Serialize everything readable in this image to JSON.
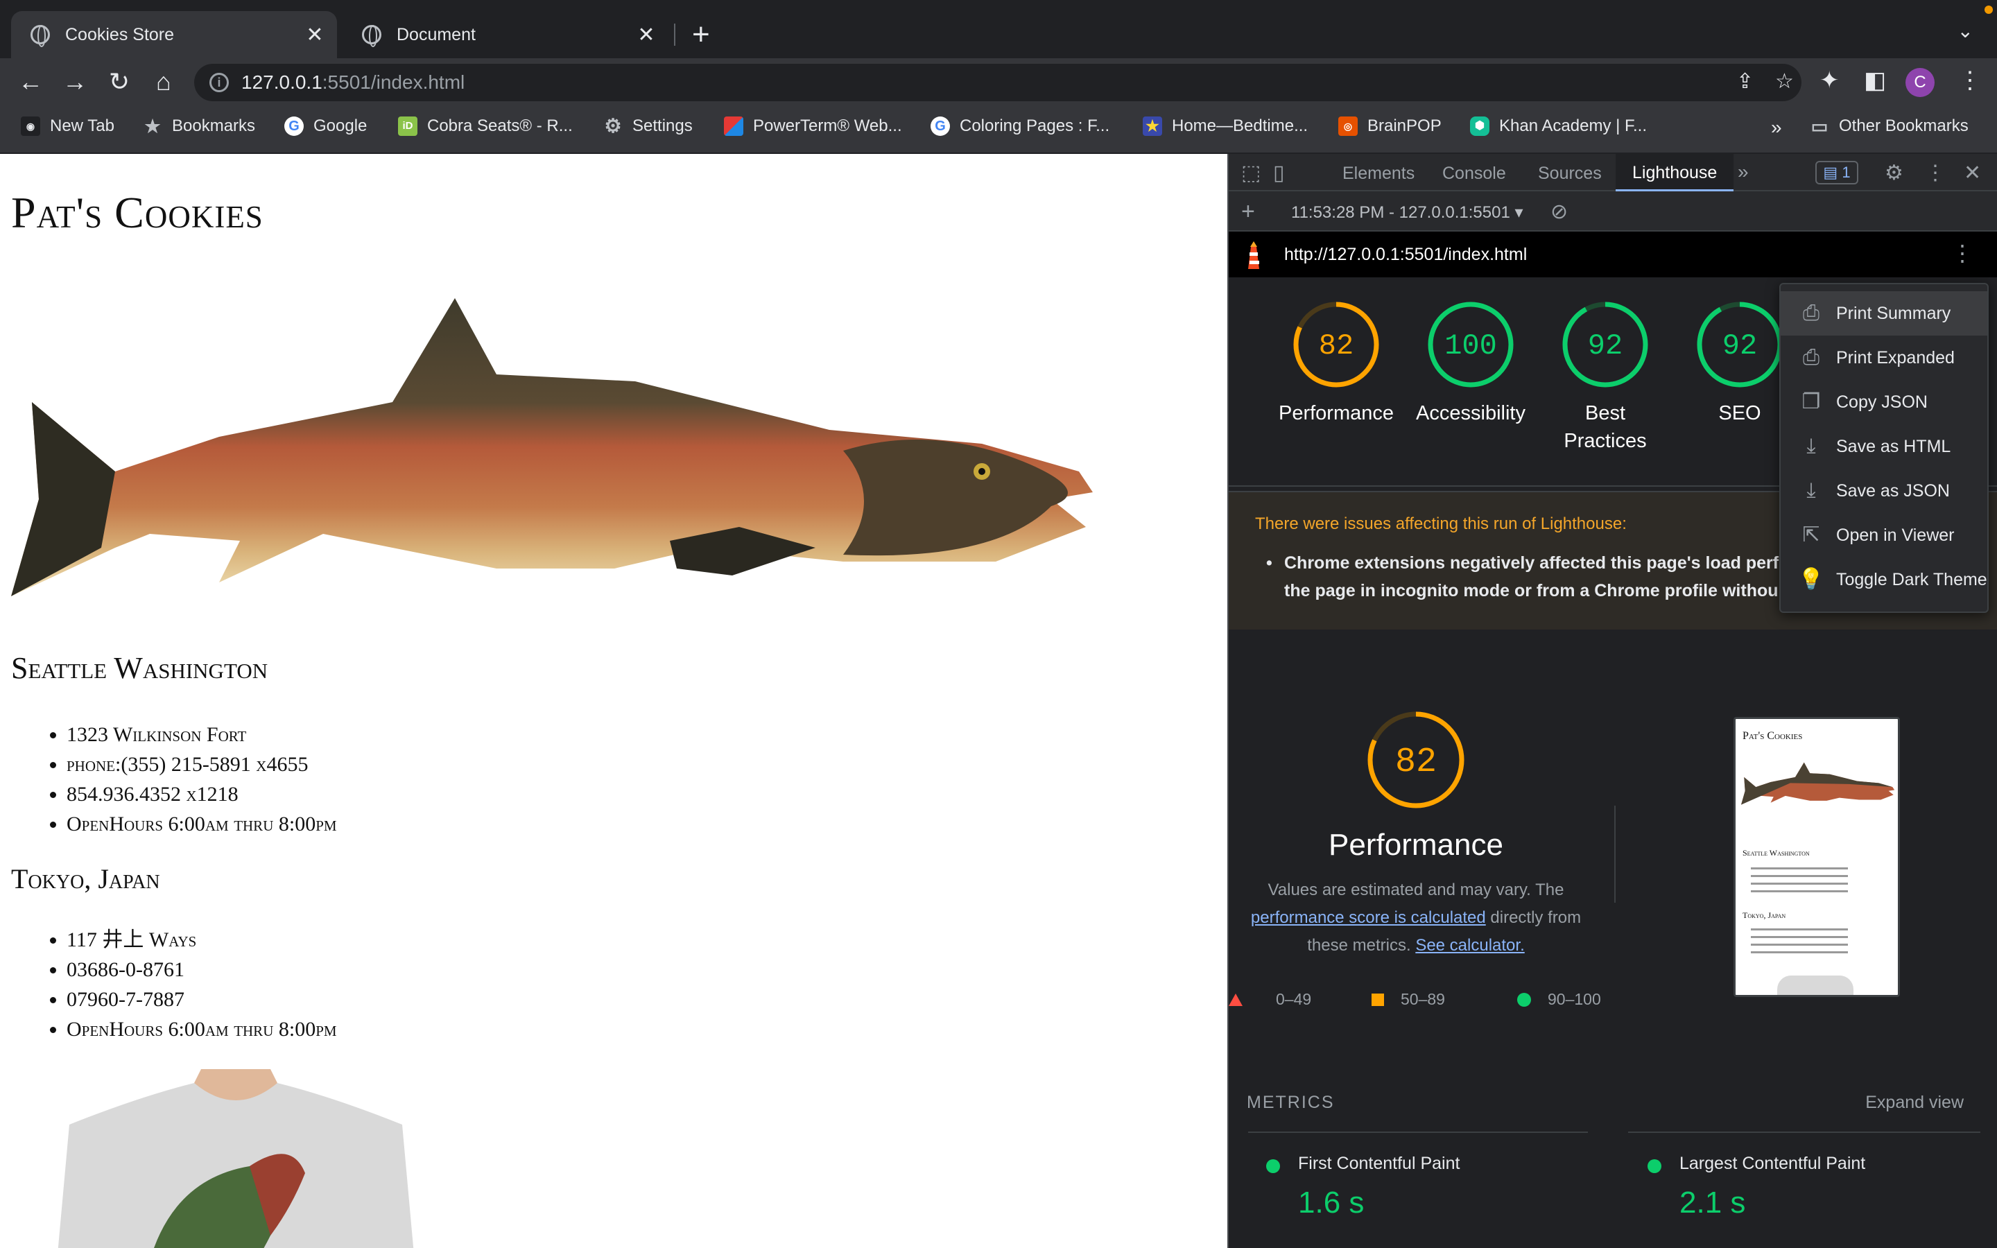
{
  "tabs": [
    {
      "title": "Cookies Store",
      "active": true
    },
    {
      "title": "Document",
      "active": false
    }
  ],
  "address_bar": {
    "host": "127.0.0.1",
    "rest": ":5501/index.html"
  },
  "bookmarks": [
    {
      "label": "New Tab",
      "icon": "new-tab-icon"
    },
    {
      "label": "Bookmarks",
      "icon": "star-icon"
    },
    {
      "label": "Google",
      "icon": "google-icon"
    },
    {
      "label": "Cobra Seats® - R...",
      "icon": "cobra-icon"
    },
    {
      "label": "Settings",
      "icon": "gear-icon"
    },
    {
      "label": "PowerTerm® Web...",
      "icon": "powerterm-icon"
    },
    {
      "label": "Coloring Pages : F...",
      "icon": "google-icon"
    },
    {
      "label": "Home—Bedtime...",
      "icon": "star-badge-icon"
    },
    {
      "label": "BrainPOP",
      "icon": "brainpop-icon"
    },
    {
      "label": "Khan Academy | F...",
      "icon": "khan-icon"
    }
  ],
  "bookmarks_more": "»",
  "other_bookmarks": "Other Bookmarks",
  "avatar_letter": "C",
  "page": {
    "title": "Pat's Cookies",
    "locations": [
      {
        "heading": "Seattle Washington",
        "items": [
          "1323 Wilkinson Fort",
          "phone:(355) 215-5891 x4655",
          "854.936.4352 x1218",
          "OpenHours 6:00am thru 8:00pm"
        ]
      },
      {
        "heading": "Tokyo, Japan",
        "items": [
          "117 井上 Ways",
          "03686-0-8761",
          "07960-7-7887",
          "OpenHours 6:00am thru 8:00pm"
        ]
      }
    ]
  },
  "devtools": {
    "tabs": [
      "Elements",
      "Console",
      "Sources",
      "Lighthouse"
    ],
    "active_tab": "Lighthouse",
    "more": "»",
    "issues_count": "1",
    "report_selector": "11:53:28 PM - 127.0.0.1:5501",
    "report_url": "http://127.0.0.1:5501/index.html",
    "scores": [
      {
        "value": 82,
        "label": "Performance",
        "color": "#ffa400"
      },
      {
        "value": 100,
        "label": "Accessibility",
        "color": "#0cce6b"
      },
      {
        "value": 92,
        "label": "Best Practices",
        "color": "#0cce6b"
      },
      {
        "value": 92,
        "label": "SEO",
        "color": "#0cce6b"
      }
    ],
    "warning_title": "There were issues affecting this run of Lighthouse:",
    "warning_line1": "Chrome extensions negatively affected this page's load perf",
    "warning_line2": "the page in incognito mode or from a Chrome profile withou",
    "perf_score": 82,
    "perf_title": "Performance",
    "perf_desc_1": "Values are estimated and may vary. The",
    "perf_link": "performance score is calculated",
    "perf_desc_2": "directly from these metrics.",
    "perf_calc_link": "See calculator.",
    "legend": [
      {
        "range": "0–49",
        "color": "#ff4e42"
      },
      {
        "range": "50–89",
        "color": "#ffa400"
      },
      {
        "range": "90–100",
        "color": "#0cce6b"
      }
    ],
    "thumb": {
      "title": "Pat's Cookies",
      "h1": "Seattle Washington",
      "h2": "Tokyo, Japan"
    },
    "metrics_header": "METRICS",
    "expand_label": "Expand view",
    "metrics": [
      {
        "name": "First Contentful Paint",
        "value": "1.6 s"
      },
      {
        "name": "Largest Contentful Paint",
        "value": "2.1 s"
      }
    ]
  },
  "context_menu": {
    "items": [
      {
        "label": "Print Summary",
        "icon": "printer-icon"
      },
      {
        "label": "Print Expanded",
        "icon": "printer-icon"
      },
      {
        "label": "Copy JSON",
        "icon": "copy-icon"
      },
      {
        "label": "Save as HTML",
        "icon": "download-icon"
      },
      {
        "label": "Save as JSON",
        "icon": "download-icon"
      },
      {
        "label": "Open in Viewer",
        "icon": "open-in-viewer-icon"
      },
      {
        "label": "Toggle Dark Theme",
        "icon": "lightbulb-icon"
      }
    ]
  }
}
